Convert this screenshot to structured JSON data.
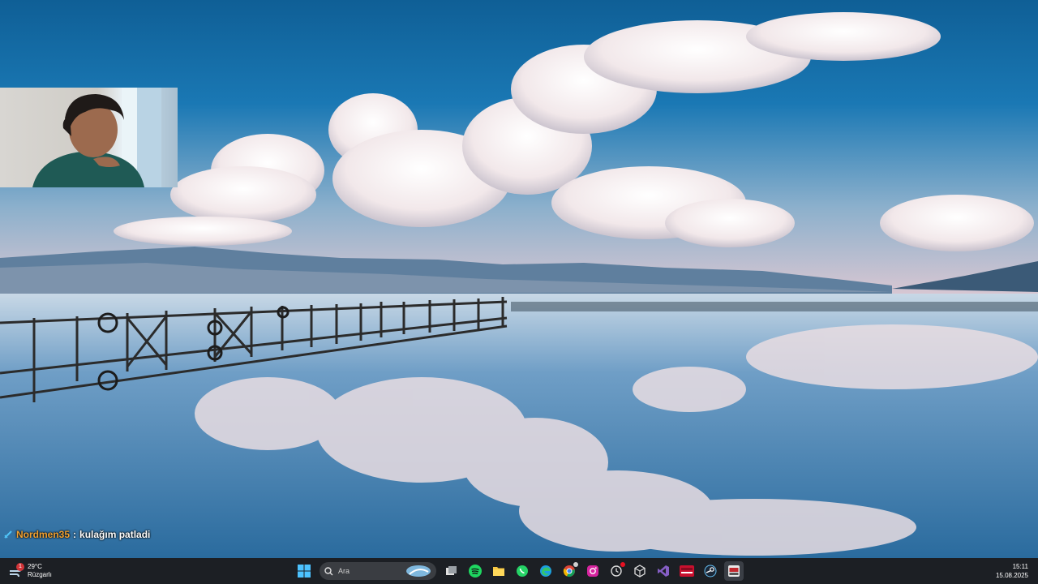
{
  "chat": {
    "username": "Nordmen35",
    "separator": ":",
    "message": "kulağım patladi"
  },
  "weather": {
    "temperature": "29°C",
    "condition": "Rüzgarlı",
    "alert_count": "1"
  },
  "taskbar": {
    "search_placeholder": "Ara",
    "apps": [
      "start-icon",
      "search",
      "task-view-icon",
      "spotify-icon",
      "file-explorer-icon",
      "whatsapp-icon",
      "edge-icon",
      "chrome-icon",
      "instagram-icon",
      "clock-app-icon",
      "unity-icon",
      "visual-studio-icon",
      "sound-mixer-icon",
      "steam-icon",
      "obs-studio-icon"
    ]
  },
  "clock": {
    "time": "15:11",
    "date": "15.08.2025"
  },
  "colors": {
    "taskbar": "#1c1f24",
    "sky": "#1a6fa6",
    "chat_username": "#f0a030"
  }
}
